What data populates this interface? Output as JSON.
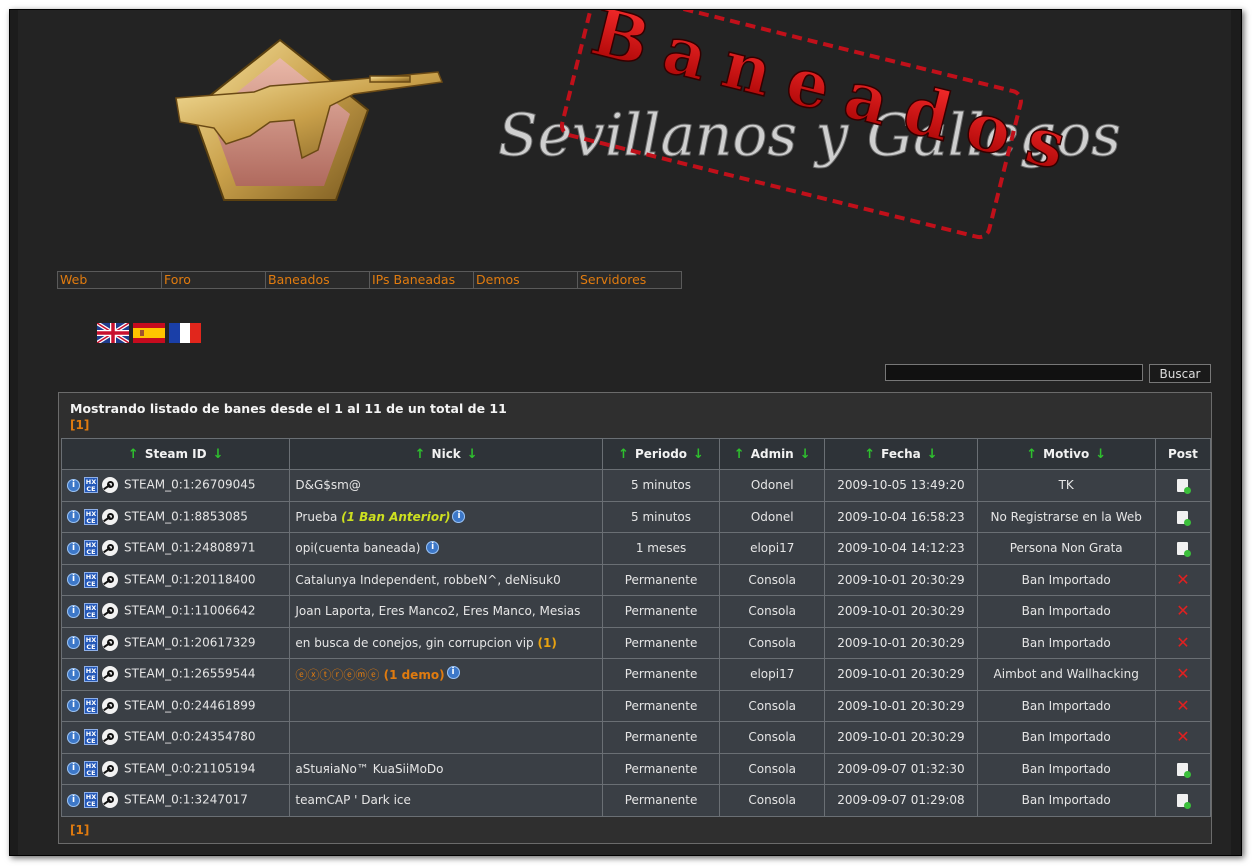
{
  "banner": {
    "title_line1": "Sevillanos y Gallegos",
    "stamp_text": "Baneados"
  },
  "nav": [
    "Web",
    "Foro",
    "Baneados",
    "IPs Baneadas",
    "Demos",
    "Servidores"
  ],
  "languages": [
    "uk-flag",
    "spain-flag",
    "france-flag"
  ],
  "search": {
    "value": "",
    "button": "Buscar"
  },
  "summary": "Mostrando listado de banes desde el 1 al 11 de un total de 11",
  "pager_top": "[1]",
  "pager_bottom": "[1]",
  "columns": [
    "Steam ID",
    "Nick",
    "Periodo",
    "Admin",
    "Fecha",
    "Motivo",
    "Post"
  ],
  "rows": [
    {
      "steam": "STEAM_0:1:26709045",
      "nick": "D&G$sm@",
      "extra": "",
      "info": false,
      "periodo": "5 minutos",
      "admin": "Odonel",
      "fecha": "2009-10-05 13:49:20",
      "motivo": "TK",
      "post": "doc"
    },
    {
      "steam": "STEAM_0:1:8853085",
      "nick": "Prueba ",
      "extra": "(1 Ban Anterior)",
      "extra_style": "prev",
      "info": true,
      "periodo": "5 minutos",
      "admin": "Odonel",
      "fecha": "2009-10-04 16:58:23",
      "motivo": "No Registrarse en la Web",
      "post": "doc"
    },
    {
      "steam": "STEAM_0:1:24808971",
      "nick": "opi(cuenta baneada) ",
      "extra": "",
      "info": true,
      "periodo": "1 meses",
      "admin": "elopi17",
      "fecha": "2009-10-04 14:12:23",
      "motivo": "Persona Non Grata",
      "post": "doc"
    },
    {
      "steam": "STEAM_0:1:20118400",
      "nick": "Catalunya Independent, robbeN^, deNisuk0",
      "extra": "",
      "info": false,
      "periodo": "Permanente",
      "admin": "Consola",
      "fecha": "2009-10-01 20:30:29",
      "motivo": "Ban Importado",
      "post": "x"
    },
    {
      "steam": "STEAM_0:1:11006642",
      "nick": "Joan Laporta, Eres Manco2, Eres Manco, Mesias",
      "extra": "",
      "info": false,
      "periodo": "Permanente",
      "admin": "Consola",
      "fecha": "2009-10-01 20:30:29",
      "motivo": "Ban Importado",
      "post": "x"
    },
    {
      "steam": "STEAM_0:1:20617329",
      "nick": "en busca de conejos, gin corrupcion vip ",
      "extra": "(1)",
      "extra_style": "demo",
      "info": false,
      "periodo": "Permanente",
      "admin": "Consola",
      "fecha": "2009-10-01 20:30:29",
      "motivo": "Ban Importado",
      "post": "x"
    },
    {
      "steam": "STEAM_0:1:26559544",
      "nick": "ⓔⓧⓣⓡⓔⓜⓔ",
      "extra": " (1 demo)",
      "extra_style": "demo2",
      "info": true,
      "periodo": "Permanente",
      "admin": "elopi17",
      "fecha": "2009-10-01 20:30:29",
      "motivo": "Aimbot and Wallhacking",
      "post": "x"
    },
    {
      "steam": "STEAM_0:0:24461899",
      "nick": "",
      "extra": "",
      "info": false,
      "periodo": "Permanente",
      "admin": "Consola",
      "fecha": "2009-10-01 20:30:29",
      "motivo": "Ban Importado",
      "post": "x"
    },
    {
      "steam": "STEAM_0:0:24354780",
      "nick": "",
      "extra": "",
      "info": false,
      "periodo": "Permanente",
      "admin": "Consola",
      "fecha": "2009-10-01 20:30:29",
      "motivo": "Ban Importado",
      "post": "x"
    },
    {
      "steam": "STEAM_0:0:21105194",
      "nick": "aStuяiaNo™ KuaSiiMoDo",
      "extra": "",
      "info": false,
      "periodo": "Permanente",
      "admin": "Consola",
      "fecha": "2009-09-07 01:32:30",
      "motivo": "Ban Importado",
      "post": "doc"
    },
    {
      "steam": "STEAM_0:1:3247017",
      "nick": "teamCAP ' Dark ice",
      "extra": "",
      "info": false,
      "periodo": "Permanente",
      "admin": "Consola",
      "fecha": "2009-09-07 01:29:08",
      "motivo": "Ban Importado",
      "post": "doc"
    }
  ]
}
